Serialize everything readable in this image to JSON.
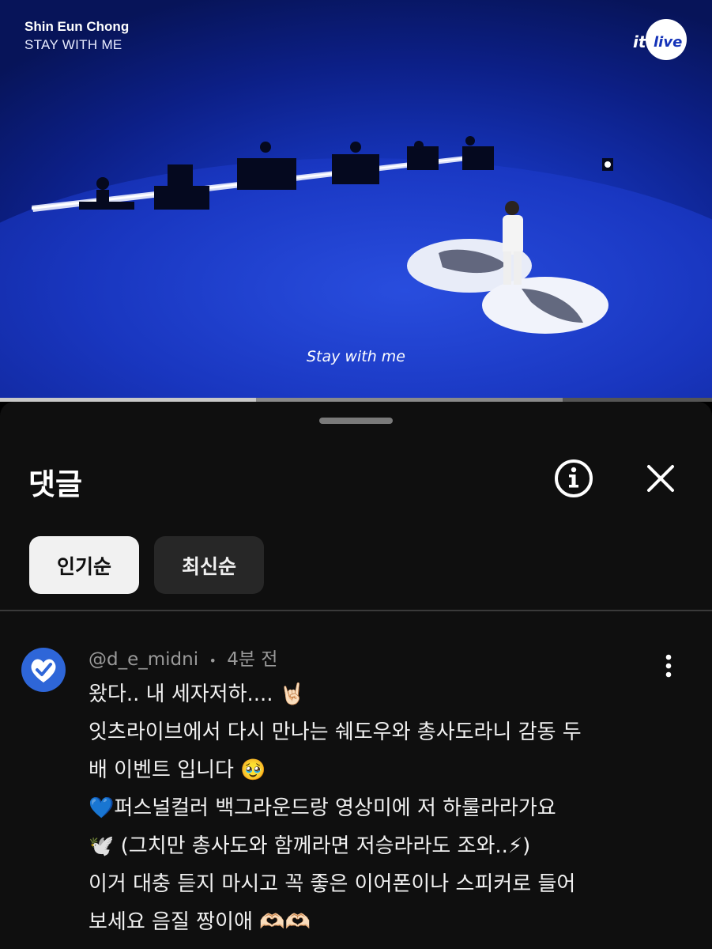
{
  "video": {
    "artist": "Shin Eun Chong",
    "song": "STAY WITH ME",
    "logo": "it's live",
    "subtitle": "Stay with me",
    "progress": 0.36,
    "buffered": 0.79
  },
  "comments_panel": {
    "title": "댓글",
    "info_icon": "info-icon",
    "close_icon": "close-icon",
    "sort_tabs": [
      {
        "label": "인기순",
        "selected": true
      },
      {
        "label": "최신순",
        "selected": false
      }
    ],
    "comments": [
      {
        "author": "@d_e_midni",
        "separator": "•",
        "time": "4분 전",
        "avatar_icon": "heart-check-icon",
        "avatar_color": "#2e66d8",
        "lines": [
          "왔다.. 내 세자저하.... 🤘🏻",
          "잇츠라이브에서 다시 만나는 쉐도우와 총사도라니 감동 두",
          "배 이벤트 입니다 🥹",
          "💙퍼스널컬러 백그라운드랑 영상미에 저 하룰라라가요",
          "🕊️ (그치만 총사도와 함께라면 저승라라도 조와..⚡)",
          "이거 대충 듣지 마시고 꼭 좋은 이어폰이나 스피커로 들어",
          "보세요 음질 짱이애 🫶🏻🫶🏻"
        ]
      }
    ]
  },
  "colors": {
    "sheet_bg": "#0f0f0f",
    "chip_active_bg": "#f1f1f1",
    "chip_inactive_bg": "#272727",
    "stage_blue": "#1533b8"
  }
}
